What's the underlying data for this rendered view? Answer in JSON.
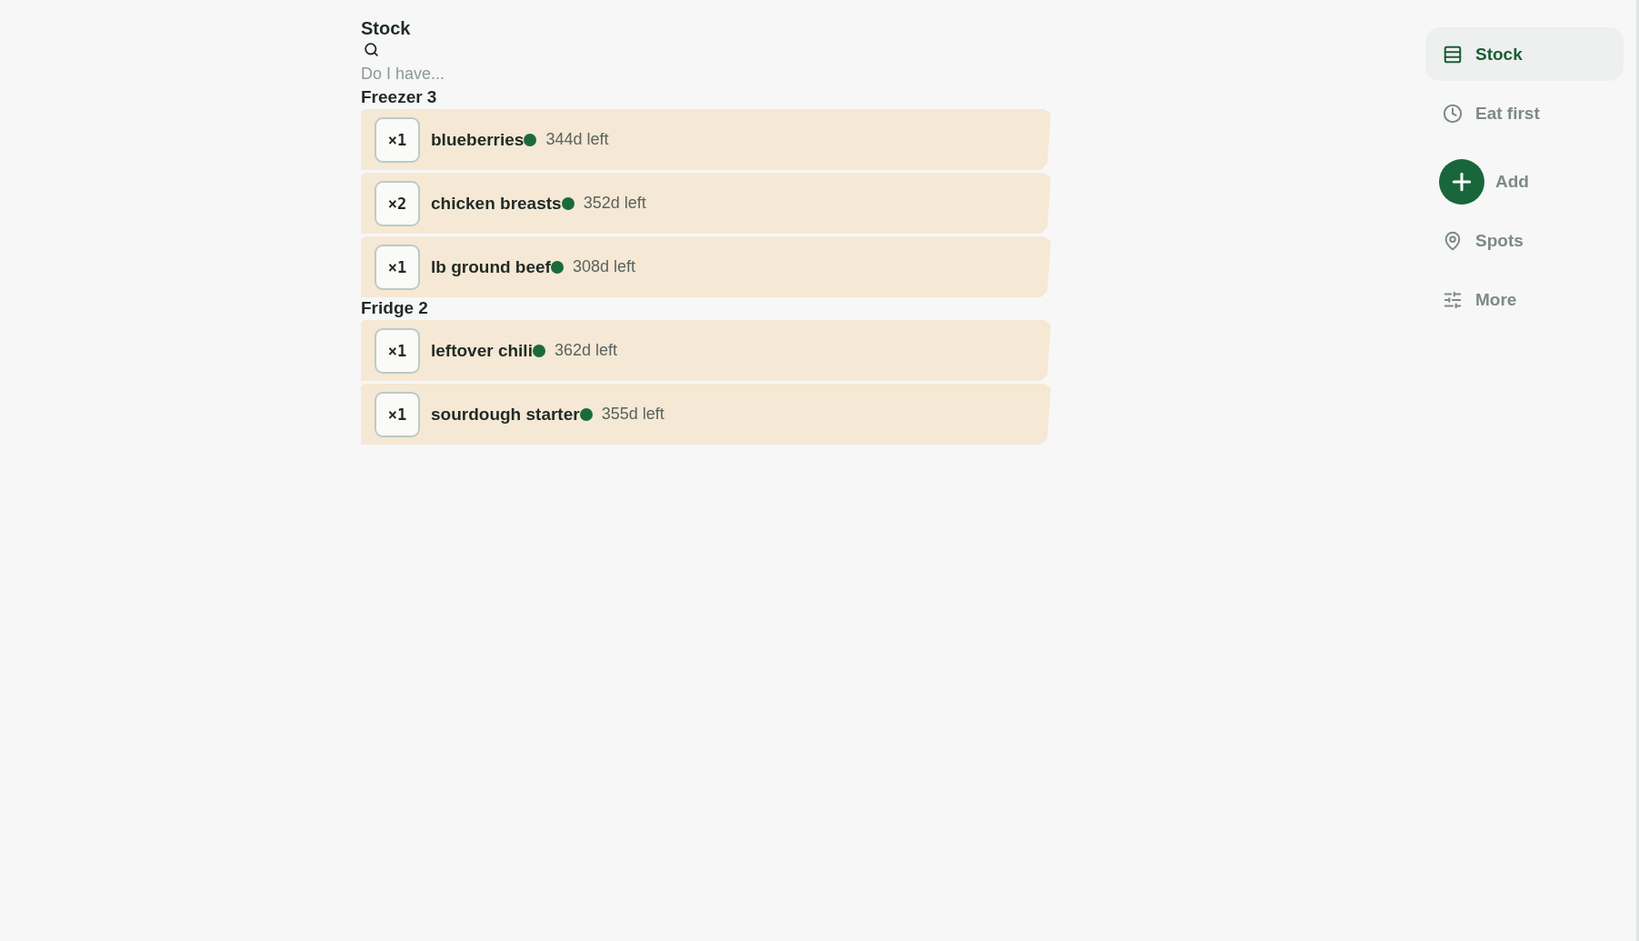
{
  "title": "Stock",
  "search": {
    "placeholder": "Do I have..."
  },
  "groups": [
    {
      "name": "Freezer 3",
      "items": [
        {
          "quantity": "×1",
          "name": "blueberries",
          "color": "#1b6b3a",
          "remaining": "344d left"
        },
        {
          "quantity": "×2",
          "name": "chicken breasts",
          "color": "#1b6b3a",
          "remaining": "352d left"
        },
        {
          "quantity": "×1",
          "name": "lb ground beef",
          "color": "#1b6b3a",
          "remaining": "308d left"
        }
      ]
    },
    {
      "name": "Fridge 2",
      "items": [
        {
          "quantity": "×1",
          "name": "leftover chili",
          "color": "#1b6b3a",
          "remaining": "362d left"
        },
        {
          "quantity": "×1",
          "name": "sourdough starter",
          "color": "#1b6b3a",
          "remaining": "355d left"
        }
      ]
    }
  ],
  "nav": [
    {
      "label": "Stock",
      "kind": "link",
      "selected": true
    },
    {
      "label": "Eat first",
      "kind": "link",
      "selected": false
    },
    {
      "label": "Add",
      "kind": "action",
      "selected": false
    },
    {
      "label": "Spots",
      "kind": "link",
      "selected": false
    },
    {
      "label": "More",
      "kind": "link",
      "selected": false
    }
  ]
}
